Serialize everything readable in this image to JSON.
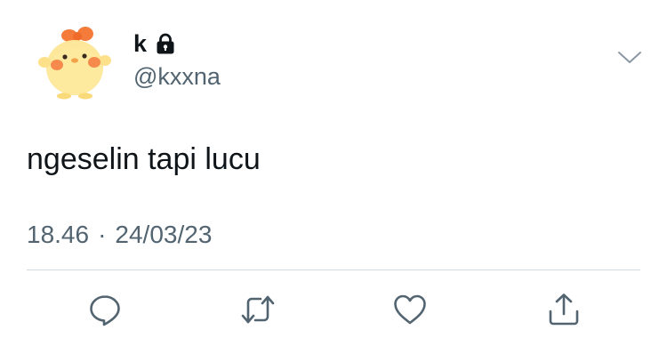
{
  "user": {
    "display_name": "k",
    "handle": "@kxxna",
    "avatar_icon": "chick-avatar",
    "protected_icon": "lock-icon"
  },
  "tweet": {
    "text": "ngeselin tapi lucu",
    "time": "18.46",
    "separator": "·",
    "date": "24/03/23"
  },
  "actions": [
    "reply-icon",
    "retweet-icon",
    "like-icon",
    "share-icon"
  ],
  "colors": {
    "text_primary": "#0f1419",
    "text_secondary": "#536471",
    "divider": "#cfd9de"
  }
}
